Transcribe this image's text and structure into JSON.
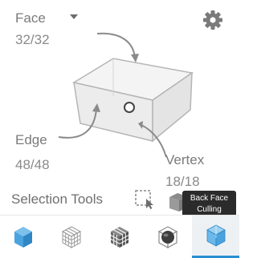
{
  "modes": {
    "face": {
      "label": "Face",
      "count": "32/32"
    },
    "edge": {
      "label": "Edge",
      "count": "48/48"
    },
    "vertex": {
      "label": "Vertex",
      "count": "18/18"
    }
  },
  "selection_tools": {
    "title": "Selection Tools",
    "tooltip_line1": "Back Face",
    "tooltip_line2": "Culling"
  },
  "toolbar": {
    "items": [
      {
        "icon": "solid-cube-icon",
        "active": false
      },
      {
        "icon": "wire-grid-cube-icon",
        "active": false
      },
      {
        "icon": "dark-grid-cube-icon",
        "active": false
      },
      {
        "icon": "sphere-in-cube-icon",
        "active": false
      },
      {
        "icon": "translucent-cube-icon",
        "active": true
      }
    ]
  },
  "colors": {
    "accent": "#2a8fd2",
    "icon_blue": "#4aa3df",
    "tooltip_bg": "#2b2b2b"
  }
}
